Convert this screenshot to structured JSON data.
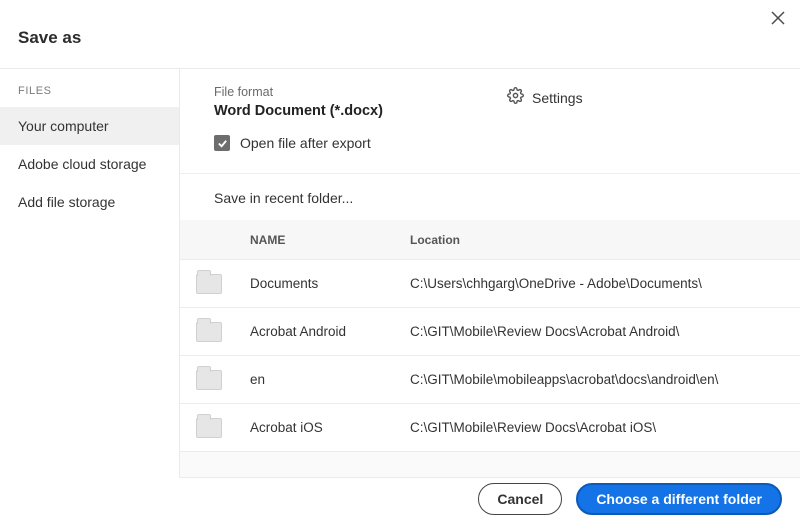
{
  "dialog": {
    "title": "Save as",
    "close_icon": "close"
  },
  "sidebar": {
    "heading": "FILES",
    "items": [
      {
        "label": "Your computer",
        "selected": true
      },
      {
        "label": "Adobe cloud storage",
        "selected": false
      },
      {
        "label": "Add file storage",
        "selected": false
      }
    ]
  },
  "file_format": {
    "label": "File format",
    "value": "Word Document (*.docx)"
  },
  "settings_label": "Settings",
  "open_after": {
    "checked": true,
    "label": "Open file after export"
  },
  "recent_label": "Save in recent folder...",
  "table": {
    "headers": {
      "name": "NAME",
      "location": "Location"
    },
    "rows": [
      {
        "name": "Documents",
        "location": "C:\\Users\\chhgarg\\OneDrive - Adobe\\Documents\\"
      },
      {
        "name": "Acrobat Android",
        "location": "C:\\GIT\\Mobile\\Review Docs\\Acrobat Android\\"
      },
      {
        "name": "en",
        "location": "C:\\GIT\\Mobile\\mobileapps\\acrobat\\docs\\android\\en\\"
      },
      {
        "name": "Acrobat iOS",
        "location": "C:\\GIT\\Mobile\\Review Docs\\Acrobat iOS\\"
      }
    ]
  },
  "footer": {
    "cancel": "Cancel",
    "choose": "Choose a different folder"
  }
}
